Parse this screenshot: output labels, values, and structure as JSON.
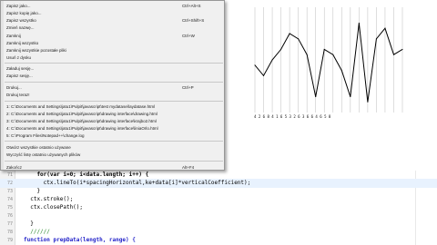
{
  "file_menu": {
    "items": [
      {
        "label": "Zapisz jako...",
        "shortcut": "Ctrl+Alt+S",
        "disabled": false
      },
      {
        "label": "Zapisz kopię jako...",
        "shortcut": "",
        "disabled": false
      },
      {
        "label": "Zapisz wszystko",
        "shortcut": "Ctrl+Shift+S",
        "disabled": false
      },
      {
        "label": "Zmień nazwę...",
        "shortcut": "",
        "disabled": false
      },
      {
        "label": "Zamknij",
        "shortcut": "Ctrl+W",
        "disabled": false
      },
      {
        "label": "Zamknij wszystko",
        "shortcut": "",
        "disabled": false
      },
      {
        "label": "Zamknij wszystkie pozostałe pliki",
        "shortcut": "",
        "disabled": false
      },
      {
        "label": "Usuń z dysku",
        "shortcut": "",
        "disabled": false
      },
      {
        "label": "Załaduj sesję...",
        "shortcut": "",
        "disabled": false
      },
      {
        "label": "Zapisz sesję...",
        "shortcut": "",
        "disabled": false
      },
      {
        "label": "Drukuj...",
        "shortcut": "Ctrl+P",
        "disabled": false
      },
      {
        "label": "Drukuj teraz!",
        "shortcut": "",
        "disabled": false
      },
      {
        "label": "1: C:\\Documents and Settings\\jatu1\\Pulpit\\javascript\\test mydatase\\laydatase.html",
        "shortcut": "",
        "disabled": false
      },
      {
        "label": "2: C:\\Documents and Settings\\jatu1\\Pulpit\\javascript\\drawing interface\\drawing.html",
        "shortcut": "",
        "disabled": false
      },
      {
        "label": "3: C:\\Documents and Settings\\jatu1\\Pulpit\\javascript\\drawing interface\\krajbo2.html",
        "shortcut": "",
        "disabled": false
      },
      {
        "label": "4: C:\\Documents and Settings\\jatu1\\Pulpit\\javascript\\drawing interface\\liniaOrlo.html",
        "shortcut": "",
        "disabled": false
      },
      {
        "label": "5: C:\\Program Files\\Notepad++\\change.log",
        "shortcut": "",
        "disabled": false
      },
      {
        "label": "Otwórz wszystkie ostatnio używane",
        "shortcut": "",
        "disabled": false
      },
      {
        "label": "Wyczyść listę ostatnio używanych plików",
        "shortcut": "",
        "disabled": false
      },
      {
        "label": "Zakończ",
        "shortcut": "Alt+F4",
        "disabled": false
      }
    ]
  },
  "editor": {
    "lines": [
      {
        "num": "71",
        "text": "    for(var i=0; i<data.length; i++) {",
        "current": false
      },
      {
        "num": "72",
        "text": "      ctx.lineTo(i*spacingHorizontal,ke+data[i]*verticalCoefficient);",
        "current": true
      },
      {
        "num": "73",
        "text": "    }",
        "current": false
      },
      {
        "num": "74",
        "text": "  ctx.stroke();",
        "current": false
      },
      {
        "num": "75",
        "text": "  ctx.closePath();",
        "current": false
      },
      {
        "num": "76",
        "text": "",
        "current": false
      },
      {
        "num": "77",
        "text": "  }",
        "current": false
      },
      {
        "num": "78",
        "text": "  //////",
        "current": false
      },
      {
        "num": "79",
        "text": "function prepData(length, range) {",
        "current": false
      }
    ]
  },
  "chart_data": {
    "type": "line",
    "title": "",
    "xlabel": "",
    "ylabel": "",
    "tick_labels": "4 2 6 8 4 1 6 5 3 2 6 3 6 6 4 6 5 8",
    "values": [
      45,
      35,
      50,
      60,
      75,
      70,
      55,
      15,
      60,
      55,
      40,
      15,
      85,
      10,
      70,
      80,
      55,
      60
    ],
    "ylim": [
      0,
      100
    ],
    "grid": true,
    "line_color": "#000000",
    "grid_color": "#c8c8c8"
  }
}
